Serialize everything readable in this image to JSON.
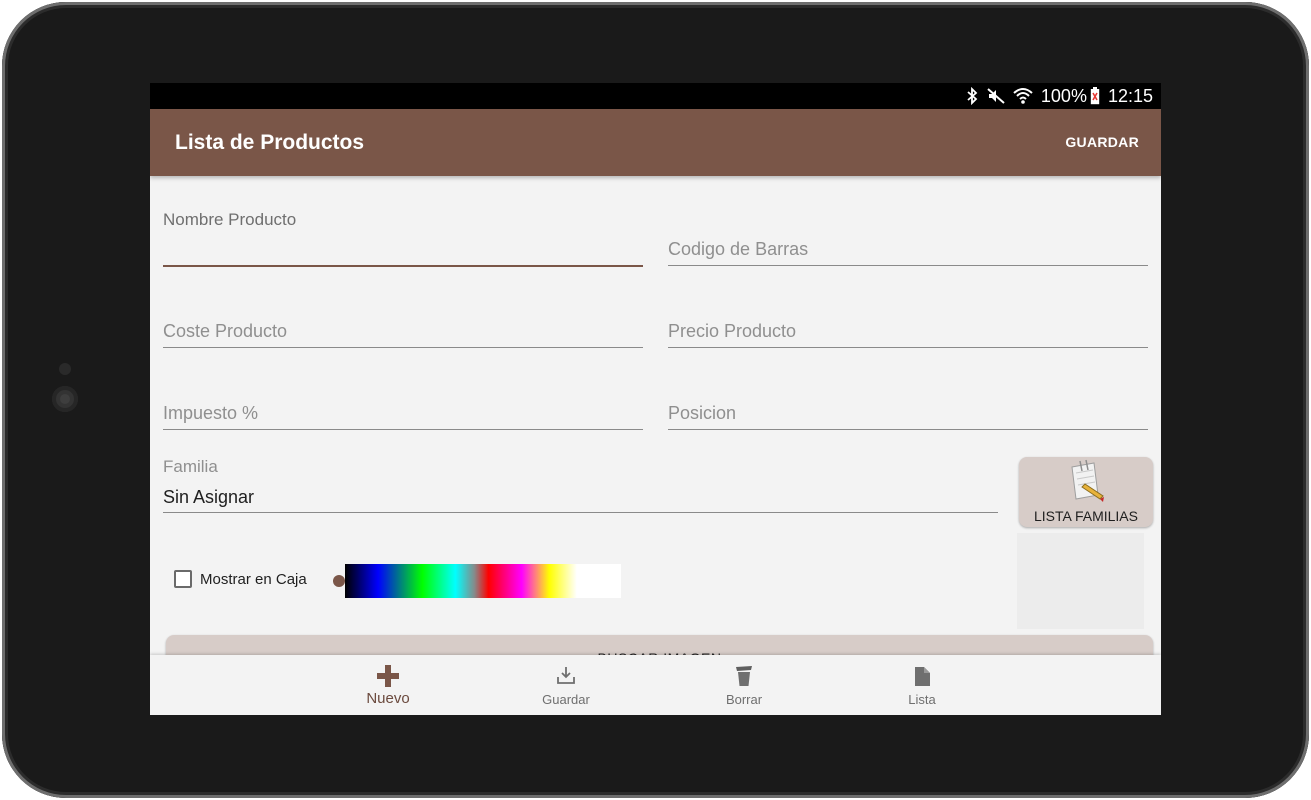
{
  "status_bar": {
    "battery": "100%",
    "time": "12:15",
    "icons": [
      "bluetooth-icon",
      "mute-icon",
      "wifi-icon",
      "battery-icon"
    ]
  },
  "app_bar": {
    "title": "Lista de Productos",
    "action": "GUARDAR",
    "color": "#7a5648"
  },
  "form": {
    "nombre": {
      "label": "Nombre Producto",
      "value": ""
    },
    "codigo": {
      "placeholder": "Codigo de Barras"
    },
    "coste": {
      "placeholder": "Coste Producto"
    },
    "precio": {
      "placeholder": "Precio Producto"
    },
    "impuesto": {
      "placeholder": "Impuesto %"
    },
    "posicion": {
      "placeholder": "Posicion"
    },
    "familia": {
      "label": "Familia",
      "value": "Sin Asignar"
    },
    "lista_familias_button": "LISTA FAMILIAS",
    "mostrar_en_caja": {
      "label": "Mostrar en Caja",
      "checked": false
    },
    "buscar_imagen_button": "BUSCAR IMAGEN"
  },
  "bottom_nav": {
    "items": [
      {
        "label": "Nuevo",
        "icon": "plus-icon",
        "active": true
      },
      {
        "label": "Guardar",
        "icon": "download-icon",
        "active": false
      },
      {
        "label": "Borrar",
        "icon": "trash-icon",
        "active": false
      },
      {
        "label": "Lista",
        "icon": "list-icon",
        "active": false
      }
    ]
  },
  "colors": {
    "accent": "#7a5648",
    "button_bg": "#d7ccc8",
    "screen_bg": "#f3f3f3"
  }
}
